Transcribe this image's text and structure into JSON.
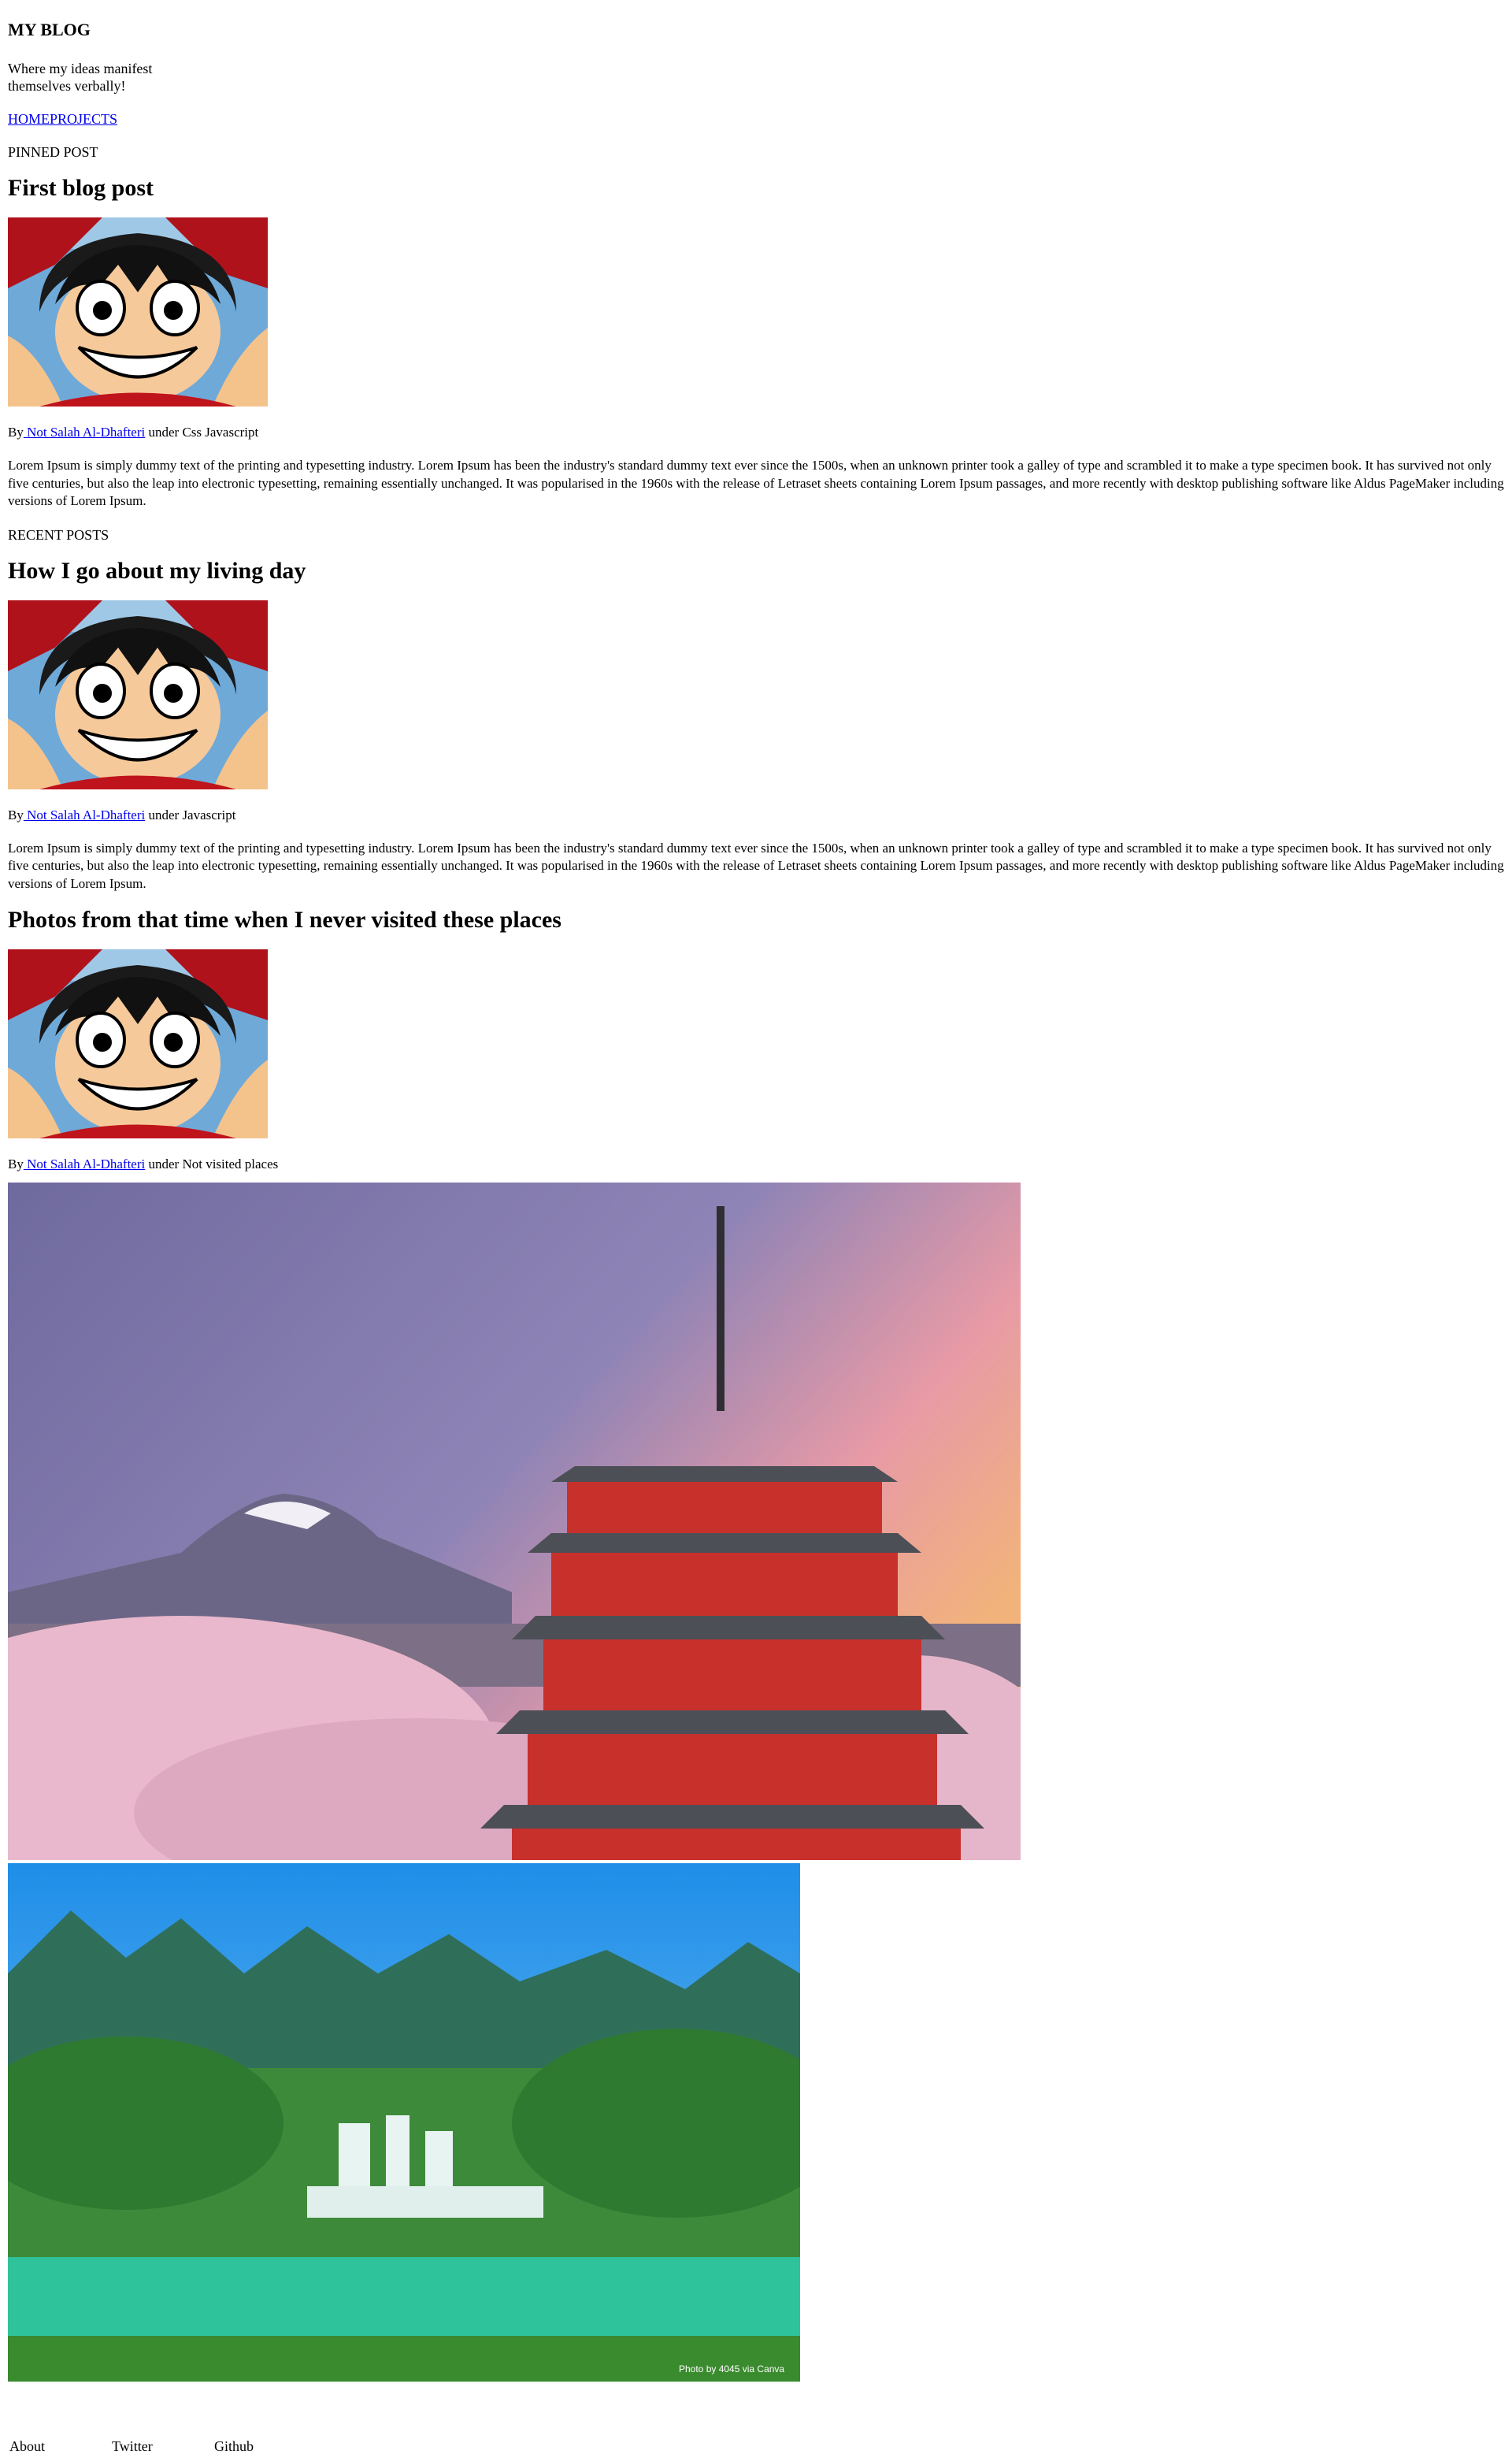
{
  "header": {
    "title": "MY BLOG",
    "tagline": "Where my ideas manifest themselves verbally!",
    "nav": {
      "home": "HOME",
      "projects": "PROJECTS"
    }
  },
  "pinned": {
    "label": "PINNED POST",
    "post": {
      "title": "First blog post",
      "by": "By",
      "author": " Not Salah Al-Dhafteri",
      "under": " under Css Javascript",
      "body": "Lorem Ipsum is simply dummy text of the printing and typesetting industry. Lorem Ipsum has been the industry's standard dummy text ever since the 1500s, when an unknown printer took a galley of type and scrambled it to make a type specimen book. It has survived not only five centuries, but also the leap into electronic typesetting, remaining essentially unchanged. It was popularised in the 1960s with the release of Letraset sheets containing Lorem Ipsum passages, and more recently with desktop publishing software like Aldus PageMaker including versions of Lorem Ipsum."
    }
  },
  "recent": {
    "label": "RECENT POSTS",
    "posts": [
      {
        "title": "How I go about my living day",
        "by": "By",
        "author": " Not Salah Al-Dhafteri",
        "under": " under Javascript",
        "body": "Lorem Ipsum is simply dummy text of the printing and typesetting industry. Lorem Ipsum has been the industry's standard dummy text ever since the 1500s, when an unknown printer took a galley of type and scrambled it to make a type specimen book. It has survived not only five centuries, but also the leap into electronic typesetting, remaining essentially unchanged. It was popularised in the 1960s with the release of Letraset sheets containing Lorem Ipsum passages, and more recently with desktop publishing software like Aldus PageMaker including versions of Lorem Ipsum."
      },
      {
        "title": "Photos from that time when I never visited these places",
        "by": "By",
        "author": " Not Salah Al-Dhafteri",
        "under": " under Not visited places",
        "photo_credit": "Photo by 4045 via Canva"
      }
    ]
  },
  "footer": {
    "about": "About",
    "twitter": "Twitter",
    "github": "Github"
  }
}
